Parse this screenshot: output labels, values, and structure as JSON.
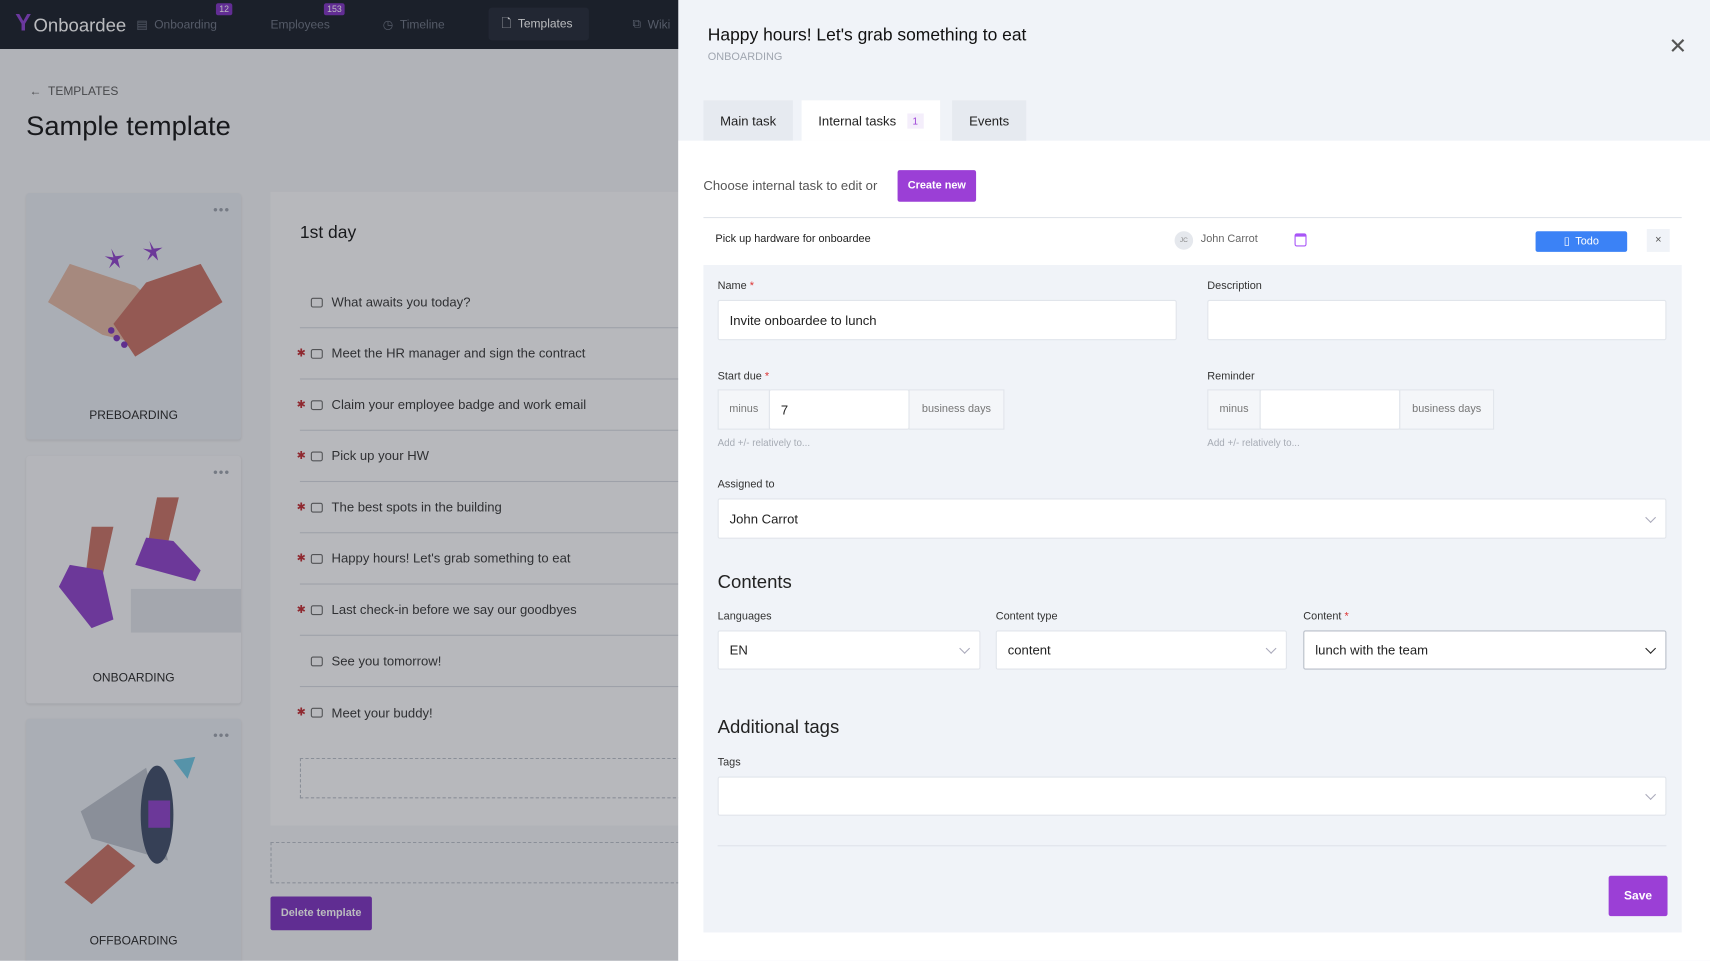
{
  "nav": {
    "logo": "Onboardee",
    "items": [
      {
        "label": "Onboarding",
        "badge": "12"
      },
      {
        "label": "Employees",
        "badge": "153"
      },
      {
        "label": "Timeline"
      },
      {
        "label": "Templates",
        "active": true
      },
      {
        "label": "Wiki"
      }
    ]
  },
  "page": {
    "breadcrumb": "TEMPLATES",
    "title": "Sample template",
    "delete_label": "Delete template"
  },
  "phases": [
    {
      "label": "PREBOARDING"
    },
    {
      "label": "ONBOARDING"
    },
    {
      "label": "OFFBOARDING"
    }
  ],
  "day": {
    "title": "1st day",
    "tasks": [
      {
        "label": "What awaits you today?",
        "required": false
      },
      {
        "label": "Meet the HR manager and sign the contract",
        "required": true
      },
      {
        "label": "Claim your employee badge and work email",
        "required": true
      },
      {
        "label": "Pick up your HW",
        "required": true
      },
      {
        "label": "The best spots in the building",
        "required": true
      },
      {
        "label": "Happy hours! Let's grab something to eat",
        "required": true
      },
      {
        "label": "Last check-in before we say our goodbyes",
        "required": true
      },
      {
        "label": "See you tomorrow!",
        "required": false
      },
      {
        "label": "Meet your buddy!",
        "required": true
      }
    ]
  },
  "drawer": {
    "title": "Happy hours! Let's grab something to eat",
    "subtitle": "ONBOARDING",
    "tabs": [
      {
        "label": "Main task"
      },
      {
        "label": "Internal tasks",
        "badge": "1"
      },
      {
        "label": "Events"
      }
    ],
    "choose_text": "Choose internal task to edit or",
    "create_label": "Create new",
    "internal_task": {
      "name": "Pick up hardware for onboardee",
      "avatar": "JC",
      "assignee": "John Carrot",
      "status": "Todo",
      "remove": "×"
    },
    "form": {
      "name_label": "Name",
      "name_value": "Invite onboardee to lunch",
      "description_label": "Description",
      "description_value": "",
      "start_due_label": "Start due",
      "start_prefix": "minus",
      "start_value": "7",
      "start_suffix": "business days",
      "start_help": "Add +/- relatively to...",
      "reminder_label": "Reminder",
      "reminder_prefix": "minus",
      "reminder_value": "",
      "reminder_suffix": "business days",
      "reminder_help": "Add +/- relatively to...",
      "assigned_label": "Assigned to",
      "assigned_value": "John Carrot",
      "contents_heading": "Contents",
      "languages_label": "Languages",
      "languages_value": "EN",
      "content_type_label": "Content type",
      "content_type_value": "content",
      "content_label": "Content",
      "content_value": "lunch with the team",
      "tags_heading": "Additional tags",
      "tags_label": "Tags",
      "tags_value": "",
      "save_label": "Save",
      "required_mark": "*"
    }
  },
  "colors": {
    "accent": "#9b3fd6",
    "todo": "#3b82f6",
    "nav": "#151b26"
  }
}
